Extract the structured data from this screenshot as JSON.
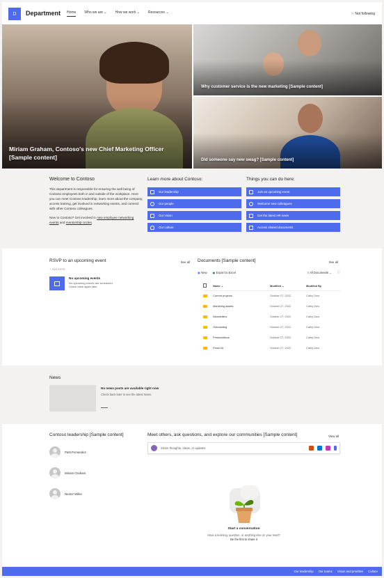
{
  "header": {
    "logo_text": "D",
    "site_title": "Department",
    "nav": [
      "Home",
      "Who we are",
      "How we work",
      "Resources"
    ],
    "follow_label": "Not following"
  },
  "hero": {
    "main_caption": "Miriam Graham, Contoso's new Chief Marketing Officer [Sample content]",
    "tile2_caption": "Why customer service is the new marketing [Sample content]",
    "tile3_caption": "Did someone say new swag? [Sample content]"
  },
  "welcome": {
    "title": "Welcome to Contoso",
    "para1": "This department is responsible for ensuring the well being of Contoso employees both in and outside of the workplace. Here you can meet Contoso leadership, learn more about the company, access training, get involved in networking events, and connect with other Contoso colleagues.",
    "para2_prefix": "New to Contoso? Get involved in ",
    "link1": "new employee networking events",
    "para2_mid": " and ",
    "link2": "mentorship circles",
    "para2_suffix": "."
  },
  "learn": {
    "title": "Learn more about Contoso:",
    "buttons": [
      "Our leadership",
      "Our people",
      "Our vision",
      "Our culture"
    ]
  },
  "things": {
    "title": "Things you can do here:",
    "buttons": [
      "Join an upcoming event",
      "Welcome new colleagues",
      "Get the latest HR news",
      "Access shared documents"
    ]
  },
  "rsvp": {
    "title": "RSVP to an upcoming event",
    "see_all": "See all",
    "add_event": "+ Add event",
    "empty_title": "No upcoming events",
    "empty_line1": "No upcoming events are scheduled.",
    "empty_line2": "Check back again later."
  },
  "documents": {
    "title": "Documents [Sample content]",
    "see_all": "See all",
    "toolbar": {
      "new": "New",
      "export": "Export to Excel",
      "view": "All Documents"
    },
    "columns": [
      "Name",
      "Modified",
      "Modified By"
    ],
    "rows": [
      {
        "name": "Current projects",
        "modified": "October 27, 2022",
        "by": "Cathy Dew"
      },
      {
        "name": "Marketing assets",
        "modified": "October 27, 2022",
        "by": "Cathy Dew"
      },
      {
        "name": "Newsletters",
        "modified": "October 27, 2022",
        "by": "Cathy Dew"
      },
      {
        "name": "Onboarding",
        "modified": "October 27, 2022",
        "by": "Cathy Dew"
      },
      {
        "name": "Presentations",
        "modified": "October 27, 2022",
        "by": "Cathy Dew"
      },
      {
        "name": "Press kit",
        "modified": "October 27, 2022",
        "by": "Cathy Dew"
      }
    ]
  },
  "news": {
    "title": "News",
    "empty_title": "No news posts are available right now",
    "empty_text": "Check back later to see the latest News."
  },
  "leadership": {
    "title": "Contoso leadership [Sample content]",
    "people": [
      "Patti Fernandez",
      "Miriam Graham",
      "Nestor Wilke"
    ]
  },
  "community": {
    "title": "Meet others, ask questions, and explore our communities [Sample content]",
    "view_all": "View all",
    "share_placeholder": "Share thoughts, ideas, or updates",
    "conv_title": "Start a conversation",
    "conv_line1": "Have a learning, question, or anything else on your mind?",
    "conv_line2": "Be the first to share it"
  },
  "footer": {
    "links": [
      "Our leadership",
      "Our teams",
      "Vision and priorities",
      "Culture"
    ]
  },
  "colors": {
    "accent": "#4f6bed",
    "folder": "#ffb900",
    "band": "#f3f2f1"
  }
}
